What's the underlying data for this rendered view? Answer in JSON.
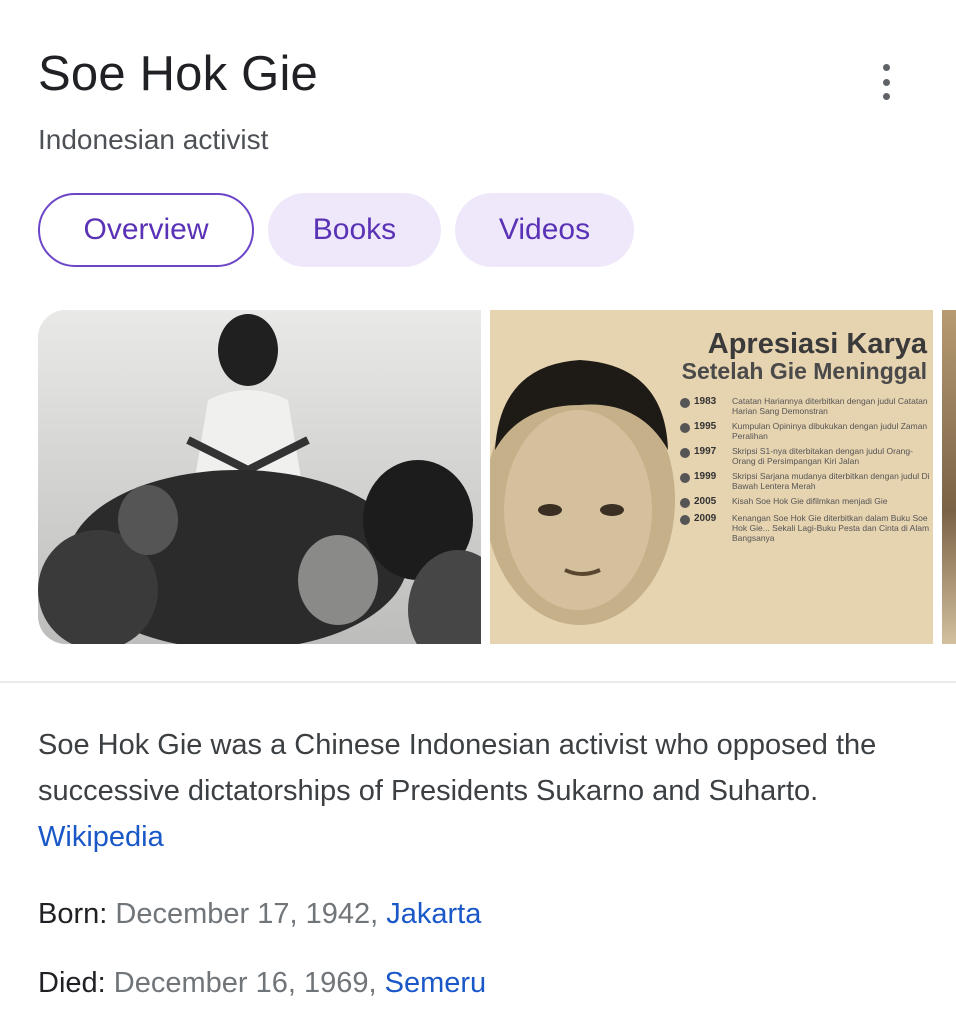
{
  "entity": {
    "title": "Soe Hok Gie",
    "subtitle": "Indonesian activist"
  },
  "tabs": [
    {
      "label": "Overview",
      "active": true
    },
    {
      "label": "Books",
      "active": false
    },
    {
      "label": "Videos",
      "active": false
    }
  ],
  "images": {
    "image2": {
      "heading1": "Apresiasi Karya",
      "heading2": "Setelah Gie Meninggal",
      "timeline": [
        {
          "year": "1983",
          "text": "Catatan Hariannya diterbitkan dengan judul Catatan Harian Sang Demonstran"
        },
        {
          "year": "1995",
          "text": "Kumpulan Opininya dibukukan dengan judul Zaman Peralihan"
        },
        {
          "year": "1997",
          "text": "Skripsi S1-nya diterbitakan dengan judul Orang-Orang di Persimpangan Kiri Jalan"
        },
        {
          "year": "1999",
          "text": "Skripsi Sarjana mudanya diterbitkan dengan judul Di Bawah Lentera Merah"
        },
        {
          "year": "2005",
          "text": "Kisah Soe Hok Gie difilmkan menjadi Gie"
        },
        {
          "year": "2009",
          "text": "Kenangan Soe Hok Gie diterbitkan dalam Buku Soe Hok Gie... Sekali Lagi-Buku Pesta dan Cinta di Alam Bangsanya"
        }
      ]
    }
  },
  "description": {
    "text": "Soe Hok Gie was a Chinese Indonesian activist who opposed the successive dictatorships of Presidents Sukarno and Suharto.",
    "source": "Wikipedia"
  },
  "facts": {
    "born": {
      "label": "Born:",
      "value": "December 17, 1942,",
      "link": "Jakarta"
    },
    "died": {
      "label": "Died:",
      "value": "December 16, 1969,",
      "link": "Semeru"
    }
  },
  "colors": {
    "accent": "#5a32b6",
    "chip_bg": "#efe8fb",
    "link": "#1a58c8"
  }
}
